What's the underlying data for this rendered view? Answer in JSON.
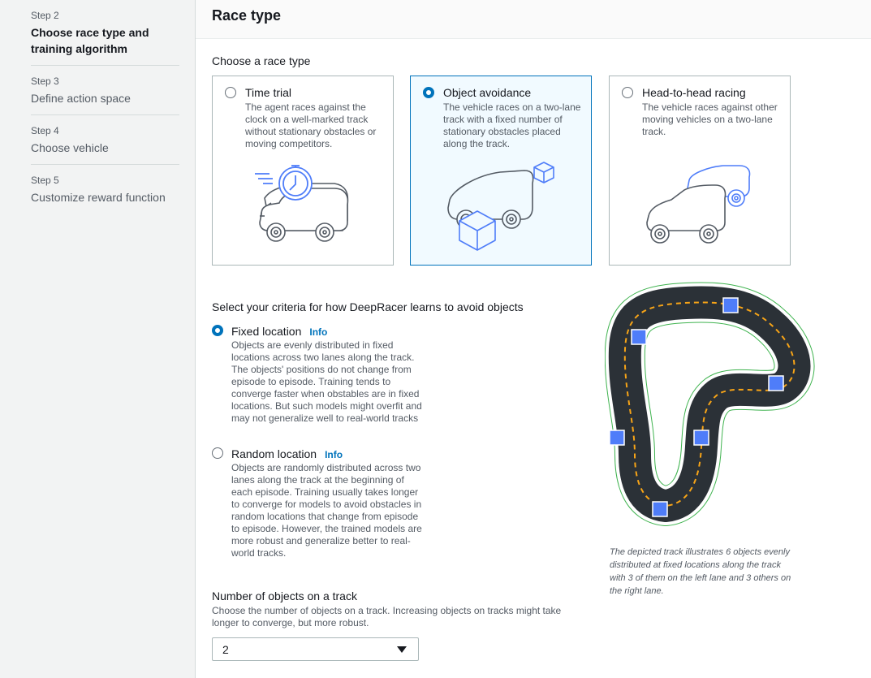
{
  "sidebar": {
    "steps": [
      {
        "num": "Step 2",
        "title": "Choose race type and training algorithm"
      },
      {
        "num": "Step 3",
        "title": "Define action space"
      },
      {
        "num": "Step 4",
        "title": "Choose vehicle"
      },
      {
        "num": "Step 5",
        "title": "Customize reward function"
      }
    ],
    "active_step": 0
  },
  "page": {
    "title": "Race type",
    "race_type_label": "Choose a race type"
  },
  "race_types": [
    {
      "title": "Time trial",
      "desc": "The agent races against the clock on a well-marked track without stationary obstacles or moving competitors.",
      "icon": "stopwatch-car-icon",
      "selected": false
    },
    {
      "title": "Object avoidance",
      "desc": "The vehicle races on a two-lane track with a fixed number of stationary obstacles placed along the track.",
      "icon": "car-with-boxes-icon",
      "selected": true
    },
    {
      "title": "Head-to-head racing",
      "desc": "The vehicle races against other moving vehicles on a two-lane track.",
      "icon": "two-cars-icon",
      "selected": false
    }
  ],
  "criteria": {
    "label": "Select your criteria for how DeepRacer learns to avoid objects",
    "info": "Info",
    "options": [
      {
        "title": "Fixed location",
        "desc": "Objects are evenly distributed in fixed locations across two lanes along the track. The objects' positions do not change from episode to episode. Training tends to converge faster when obstables are in fixed locations. But such models might overfit and may not generalize well to real-world tracks",
        "selected": true
      },
      {
        "title": "Random location",
        "desc": "Objects are randomly distributed across two lanes along the track at the beginning of each episode. Training usually takes longer to converge for models to avoid obstacles in random locations that change from episode to episode. However, the trained models are more robust and generalize better to real-world tracks.",
        "selected": false
      }
    ]
  },
  "track": {
    "caption": "The depicted track illustrates 6 objects evenly distributed at fixed locations along the track with 3 of them on the left lane and 3 others on the right lane.",
    "colors": {
      "road": "#2b3137",
      "edge": "#3fb34f",
      "centerline": "#f7a417",
      "object": "#4f7df9"
    }
  },
  "num_objects": {
    "title": "Number of objects on a track",
    "desc": "Choose the number of objects on a track. Increasing objects on tracks might take longer to converge, but more robust.",
    "value": "2"
  },
  "colors": {
    "accent": "#0073bb",
    "illustration_blue": "#4f7df9"
  }
}
